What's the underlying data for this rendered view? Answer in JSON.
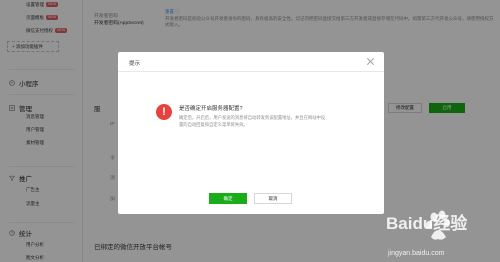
{
  "sidebar": {
    "top_items": [
      {
        "label": "设置管理",
        "badge": "NEW"
      },
      {
        "label": "页面模板",
        "badge": "NEW"
      },
      {
        "label": "微信支付授权",
        "badge": "NEW"
      }
    ],
    "add_plugin": "+ 添加功能插件",
    "sections": [
      {
        "label": "小程序",
        "icon": "mini-program-icon"
      },
      {
        "label": "管理",
        "icon": "management-icon",
        "items": [
          "消息管理",
          "用户管理",
          "素材管理"
        ]
      },
      {
        "label": "推广",
        "icon": "promotion-icon",
        "items": [
          "广告主",
          "流量主"
        ]
      },
      {
        "label": "统计",
        "icon": "statistics-icon",
        "items": [
          "用户分析",
          "图文分析"
        ]
      }
    ]
  },
  "main": {
    "dev_id_label": "开发者密码(AppSecret)",
    "reset_link": "重置",
    "appsecret_desc": "开发者密码是校验公众号开发者身份的密码，具有极高的安全性。切记勿把密码直接交给第三方开发者或直接存储在代码中。如需第三方代开发公众号，请使用授权方式接入。",
    "section_truncated": "服",
    "small_labels": [
      "IP",
      "令",
      "消",
      "加"
    ],
    "modify_button": "修改配置",
    "enable_button": "启用",
    "bottom_heading": "已绑定的微信开放平台帐号"
  },
  "dialog": {
    "title": "提示",
    "question": "是否确定开启服务器配置?",
    "detail": "确定后，开启后，用户发送的消息将自动转发到该配置地址，并且在网站中设置的自动回复和自定义菜单将失效。",
    "ok_button": "确定",
    "cancel_button": "取消"
  },
  "watermark": {
    "brand": "Baidu经验",
    "url": "jingyan.baidu.com"
  },
  "colors": {
    "primary_green": "#1aad19",
    "warning_red": "#e64340",
    "badge_red": "#e15f63",
    "link_blue": "#459ae9"
  }
}
